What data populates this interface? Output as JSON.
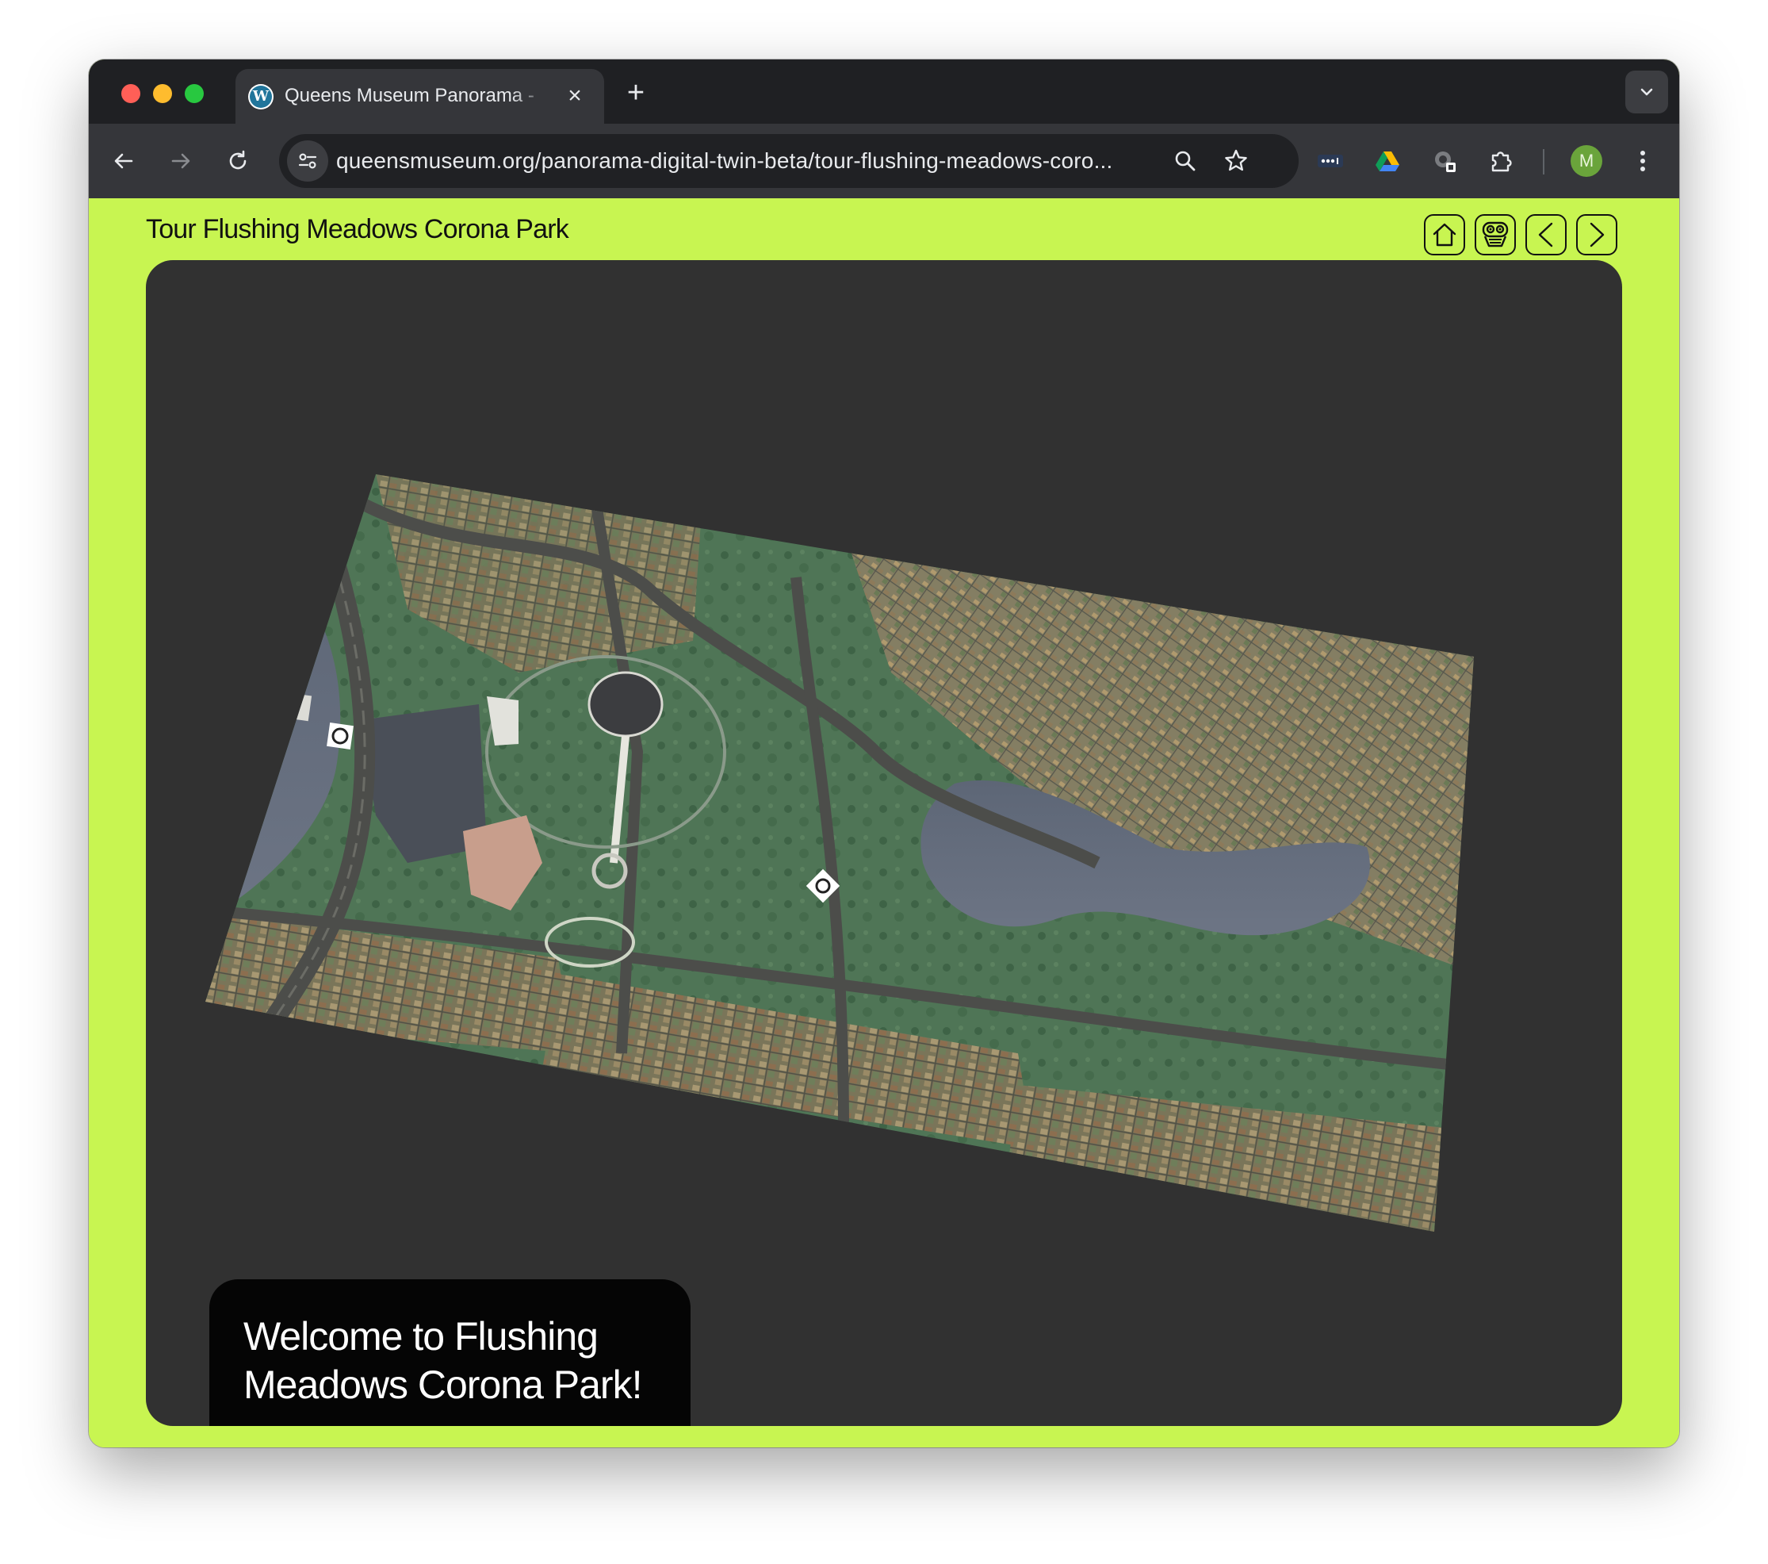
{
  "browser": {
    "tab": {
      "favicon": "wordpress-icon",
      "favicon_letter": "W",
      "title": "Queens Museum Panorama - ",
      "close_label": "×"
    },
    "new_tab_label": "+",
    "url": "queensmuseum.org/panorama-digital-twin-beta/tour-flushing-meadows-coro...",
    "avatar_letter": "M",
    "colors": {
      "frame": "#1f2023",
      "toolbar": "#35363a",
      "omnibox": "#202124",
      "avatar": "#6aa43b"
    }
  },
  "page": {
    "title": "Tour Flushing Meadows Corona Park",
    "background_color": "#c8f551",
    "viewer_color": "#313131",
    "nav_buttons": [
      {
        "name": "home",
        "icon": "home-icon"
      },
      {
        "name": "guide",
        "icon": "robot-face-icon"
      },
      {
        "name": "previous",
        "icon": "chevron-left-icon"
      },
      {
        "name": "next",
        "icon": "chevron-right-icon"
      }
    ],
    "welcome_text": "Welcome to Flushing Meadows Corona Park!"
  },
  "map": {
    "subject": "3D panorama model of Flushing Meadows Corona Park",
    "markers": [
      "location-marker-icon",
      "location-marker-icon"
    ]
  }
}
